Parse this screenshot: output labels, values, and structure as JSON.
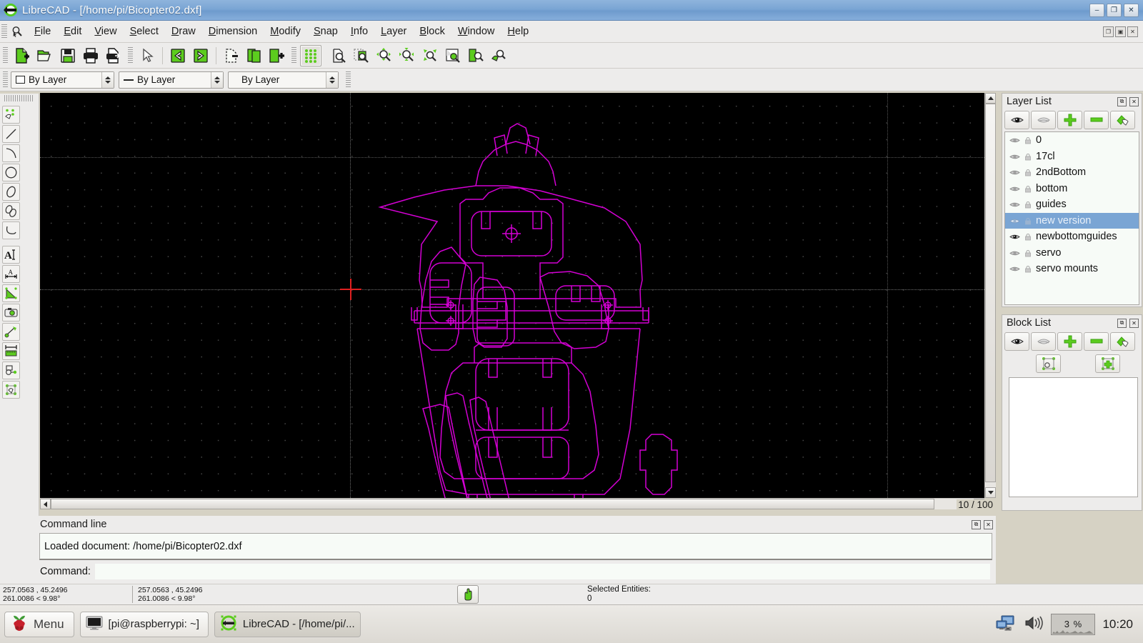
{
  "window": {
    "title": "LibreCAD - [/home/pi/Bicopter02.dxf]",
    "logo_icon": "librecad-logo-icon",
    "minimize_label": "–",
    "maximize_label": "❐",
    "close_label": "✕"
  },
  "menubar": {
    "lead_icon": "zoom-pointer-icon",
    "items": [
      {
        "label": "File",
        "mnemonic": "F"
      },
      {
        "label": "Edit",
        "mnemonic": "E"
      },
      {
        "label": "View",
        "mnemonic": "V"
      },
      {
        "label": "Select",
        "mnemonic": "S"
      },
      {
        "label": "Draw",
        "mnemonic": "D"
      },
      {
        "label": "Dimension",
        "mnemonic": "D"
      },
      {
        "label": "Modify",
        "mnemonic": "M"
      },
      {
        "label": "Snap",
        "mnemonic": "S"
      },
      {
        "label": "Info",
        "mnemonic": "I"
      },
      {
        "label": "Layer",
        "mnemonic": "L"
      },
      {
        "label": "Block",
        "mnemonic": "B"
      },
      {
        "label": "Window",
        "mnemonic": "W"
      },
      {
        "label": "Help",
        "mnemonic": "H"
      }
    ],
    "doc_restore_label": "❐",
    "doc_maximize_label": "▣",
    "doc_close_label": "✕"
  },
  "toolbar": {
    "file_tools": [
      "new-file-icon",
      "open-file-icon",
      "save-file-icon",
      "print-icon",
      "print-preview-icon"
    ],
    "edit_tools": [
      "select-pointer-icon",
      "undo-icon",
      "redo-icon"
    ],
    "clipboard_tools": [
      "cut-icon",
      "copy-icon",
      "paste-icon"
    ],
    "grid_tool": "grid-toggle-icon",
    "zoom_tools": [
      "zoom-window-icon",
      "zoom-auto-icon",
      "zoom-in-icon",
      "zoom-out-icon",
      "zoom-pan-icon",
      "zoom-previous-icon",
      "zoom-page-icon",
      "zoom-redraw-icon"
    ]
  },
  "attributes": {
    "color": {
      "label": "By Layer",
      "swatch": "color-swatch-icon"
    },
    "linetype": {
      "label": "By Layer",
      "swatch": "linetype-swatch-icon"
    },
    "linewidth": {
      "label": "By Layer"
    }
  },
  "left_palette": {
    "tools": [
      "point-tool-icon",
      "line-tool-icon",
      "arc-tool-icon",
      "circle-tool-icon",
      "ellipse-tool-icon",
      "ellipse-arc-tool-icon",
      "spline-tool-icon",
      "text-tool-icon",
      "dimension-tool-icon",
      "hatch-tool-icon",
      "image-tool-icon",
      "modify-tool-icon",
      "measure-tool-icon",
      "info-tool-icon",
      "block-tool-icon"
    ]
  },
  "canvas": {
    "zoom_indicator": "10 / 100",
    "drawing_color": "#d400d4",
    "background_color": "#000000",
    "grid_color": "#4a4a4a",
    "crosshair_color": "#e02020",
    "drawing_name": "Bicopter02 laser-cut part outlines"
  },
  "layer_list": {
    "title": "Layer List",
    "float_label": "⧉",
    "close_label": "✕",
    "tools": [
      "show-all-layers-icon",
      "hide-all-layers-icon",
      "add-layer-icon",
      "remove-layer-icon",
      "edit-layer-icon"
    ],
    "items": [
      {
        "name": "0",
        "selected": false,
        "visible": true,
        "locked": true
      },
      {
        "name": "17cl",
        "selected": false,
        "visible": true,
        "locked": true
      },
      {
        "name": "2ndBottom",
        "selected": false,
        "visible": true,
        "locked": true
      },
      {
        "name": "bottom",
        "selected": false,
        "visible": true,
        "locked": true
      },
      {
        "name": "guides",
        "selected": false,
        "visible": true,
        "locked": true
      },
      {
        "name": "new version",
        "selected": true,
        "visible": true,
        "locked": true
      },
      {
        "name": "newbottomguides",
        "selected": false,
        "visible": true,
        "locked": true
      },
      {
        "name": "servo",
        "selected": false,
        "visible": true,
        "locked": true
      },
      {
        "name": "servo mounts",
        "selected": false,
        "visible": true,
        "locked": true
      }
    ]
  },
  "block_list": {
    "title": "Block List",
    "float_label": "⧉",
    "close_label": "✕",
    "tools_row1": [
      "show-all-blocks-icon",
      "hide-all-blocks-icon",
      "add-block-icon",
      "remove-block-icon",
      "edit-block-icon"
    ],
    "tools_row2": [
      "insert-block-icon",
      "create-block-icon"
    ],
    "items": []
  },
  "command_line": {
    "title": "Command line",
    "float_label": "⧉",
    "close_label": "✕",
    "output": "Loaded document: /home/pi/Bicopter02.dxf",
    "prompt": "Command:",
    "input_value": ""
  },
  "status_bar": {
    "absolute_coords": "257.0563 , 45.2496",
    "absolute_polar": "261.0086 < 9.98°",
    "relative_coords": "257.0563 , 45.2496",
    "relative_polar": "261.0086 < 9.98°",
    "mouse_button_icon": "hand-pan-icon",
    "selected_entities_label": "Selected Entities:",
    "selected_entities_count": "0"
  },
  "taskbar": {
    "menu_label": "Menu",
    "menu_icon": "raspberry-pi-icon",
    "windows": [
      {
        "label": "[pi@raspberrypi: ~]",
        "icon": "terminal-icon",
        "active": false
      },
      {
        "label": "LibreCAD - [/home/pi/...",
        "icon": "librecad-logo-icon",
        "active": true
      }
    ],
    "tray": {
      "network_icon": "network-disconnected-icon",
      "volume_icon": "volume-icon",
      "cpu_label": "3 %",
      "clock": "10:20"
    }
  }
}
